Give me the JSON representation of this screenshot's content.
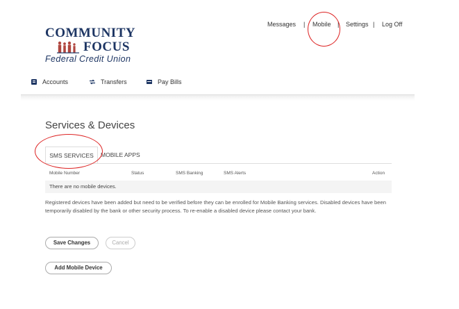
{
  "logo": {
    "line1": "COMMUNITY",
    "line2": "FOCUS",
    "line3": "Federal Credit Union"
  },
  "topnav": {
    "messages": "Messages",
    "sep": "|",
    "mobile": "Mobile",
    "settings": "Settings",
    "logoff": "Log Off"
  },
  "mainnav": {
    "accounts": "Accounts",
    "transfers": "Transfers",
    "paybills": "Pay Bills"
  },
  "page": {
    "title": "Services & Devices"
  },
  "tabs": {
    "sms": "SMS SERVICES",
    "apps": "MOBILE APPS"
  },
  "table": {
    "headers": [
      "Mobile Number",
      "Status",
      "SMS Banking",
      "SMS Alerts",
      "Action"
    ],
    "empty": "There are no mobile devices."
  },
  "info": "Registered devices have been added but need to be verified before they can be enrolled for Mobile Banking services. Disabled devices have been temporarily disabled by the bank or other security process. To re-enable a disabled device please contact your bank.",
  "buttons": {
    "save": "Save Changes",
    "cancel": "Cancel",
    "add": "Add Mobile Device"
  },
  "colors": {
    "brand": "#1d3563",
    "figures": "#b0463f",
    "annotation": "#dd2222"
  }
}
